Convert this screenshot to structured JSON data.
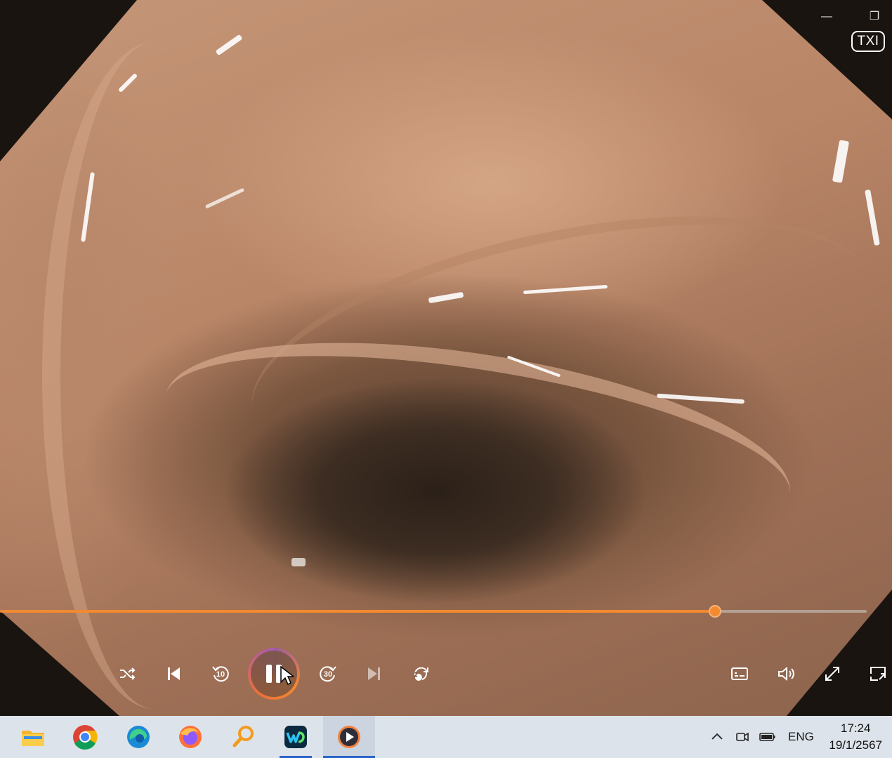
{
  "window": {
    "minimize_glyph": "—",
    "restore_glyph": "❐"
  },
  "video": {
    "overlay_badge": "TXI"
  },
  "playback": {
    "progress_fraction": 0.825,
    "seek_color": "#f28a30"
  },
  "controls": {
    "skip_back_seconds": "10",
    "skip_forward_seconds": "30",
    "repeat_badge": "1",
    "buttons": [
      "shuffle",
      "previous",
      "skip-back-10",
      "pause",
      "skip-forward-30",
      "next",
      "repeat-one",
      "subtitles",
      "volume",
      "fullscreen",
      "mini-player"
    ]
  },
  "taskbar": {
    "apps": [
      "file-explorer",
      "chrome",
      "edge",
      "firefox",
      "search-magnifier",
      "webex",
      "media-player"
    ],
    "tray": {
      "language": "ENG"
    },
    "clock": {
      "time": "17:24",
      "date": "19/1/2567"
    }
  }
}
